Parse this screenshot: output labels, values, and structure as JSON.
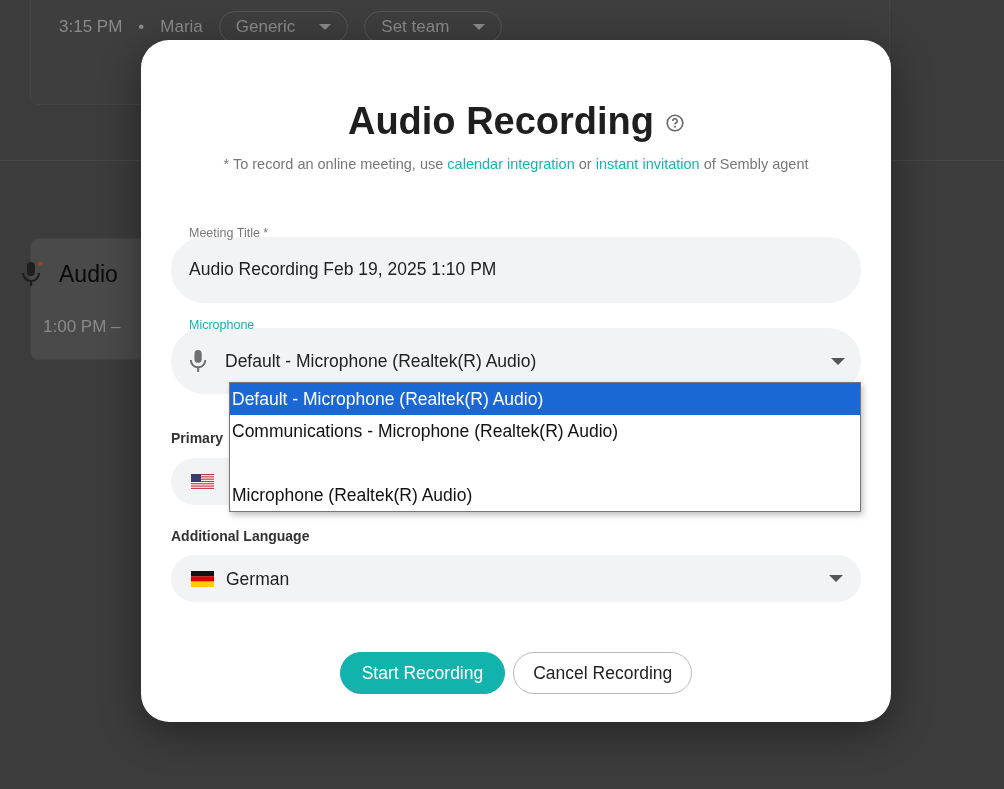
{
  "background": {
    "top_card": {
      "time": "3:15 PM",
      "separator": "•",
      "owner": "Maria",
      "type_dropdown": "Generic",
      "team_dropdown": "Set team"
    },
    "recording_card": {
      "title": "Audio",
      "time": "1:00 PM –"
    }
  },
  "dialog": {
    "title": "Audio Recording",
    "note": [
      {
        "kind": "text",
        "text": "* To record an online meeting, use "
      },
      {
        "kind": "link",
        "text": "calendar integration"
      },
      {
        "kind": "text",
        "text": " or "
      },
      {
        "kind": "link",
        "text": "instant invitation"
      },
      {
        "kind": "text",
        "text": " of Sembly agent"
      }
    ],
    "meeting_title": {
      "label": "Meeting Title *",
      "value": "Audio Recording Feb 19, 2025 1:10 PM",
      "focused": false
    },
    "microphone": {
      "label": "Microphone",
      "value": "Default - Microphone (Realtek(R) Audio)",
      "focused": true
    },
    "microphone_options": [
      {
        "label": "Default - Microphone (Realtek(R) Audio)",
        "selected": true
      },
      {
        "label": "Communications - Microphone (Realtek(R) Audio)",
        "selected": false
      },
      {
        "selected": false
      },
      {
        "label": "Microphone (Realtek(R) Audio)",
        "selected": false
      }
    ],
    "primary_language": {
      "label": "Primary"
    },
    "additional_language": {
      "label": "Additional Language",
      "value": "German"
    },
    "buttons": [
      {
        "kind": "primary",
        "label": "Start Recording"
      },
      {
        "kind": "outline",
        "label": "Cancel Recording"
      }
    ]
  }
}
